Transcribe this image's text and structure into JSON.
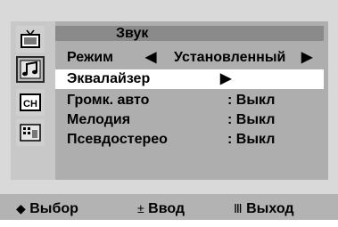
{
  "menu": {
    "title": "Звук",
    "rows": [
      {
        "label": "Режим",
        "left_arrow": "◀",
        "value": "Установленный",
        "right_arrow": "▶"
      },
      {
        "label": "Эквалайзер",
        "value": "▶"
      },
      {
        "label": "Громк. авто",
        "value": ": Выкл"
      },
      {
        "label": "Мелодия",
        "value": ": Выкл"
      },
      {
        "label": "Псевдостерео",
        "value": ": Выкл"
      }
    ]
  },
  "sidebar": {
    "icons": [
      "tv-picture-icon",
      "sound-icon",
      "channel-icon",
      "setup-icon"
    ],
    "active_index": 1,
    "channel_text": "CH"
  },
  "footer": {
    "select_symbol": "◆",
    "select_label": "Выбор",
    "enter_symbol": "±",
    "enter_label": "Ввод",
    "exit_symbol": "Ⅲ",
    "exit_label": "Выход"
  },
  "colors": {
    "highlight": "#ffffff",
    "header": "#8a8a8a",
    "panel": "#aeaeae",
    "footer": "#b3b3b3"
  }
}
